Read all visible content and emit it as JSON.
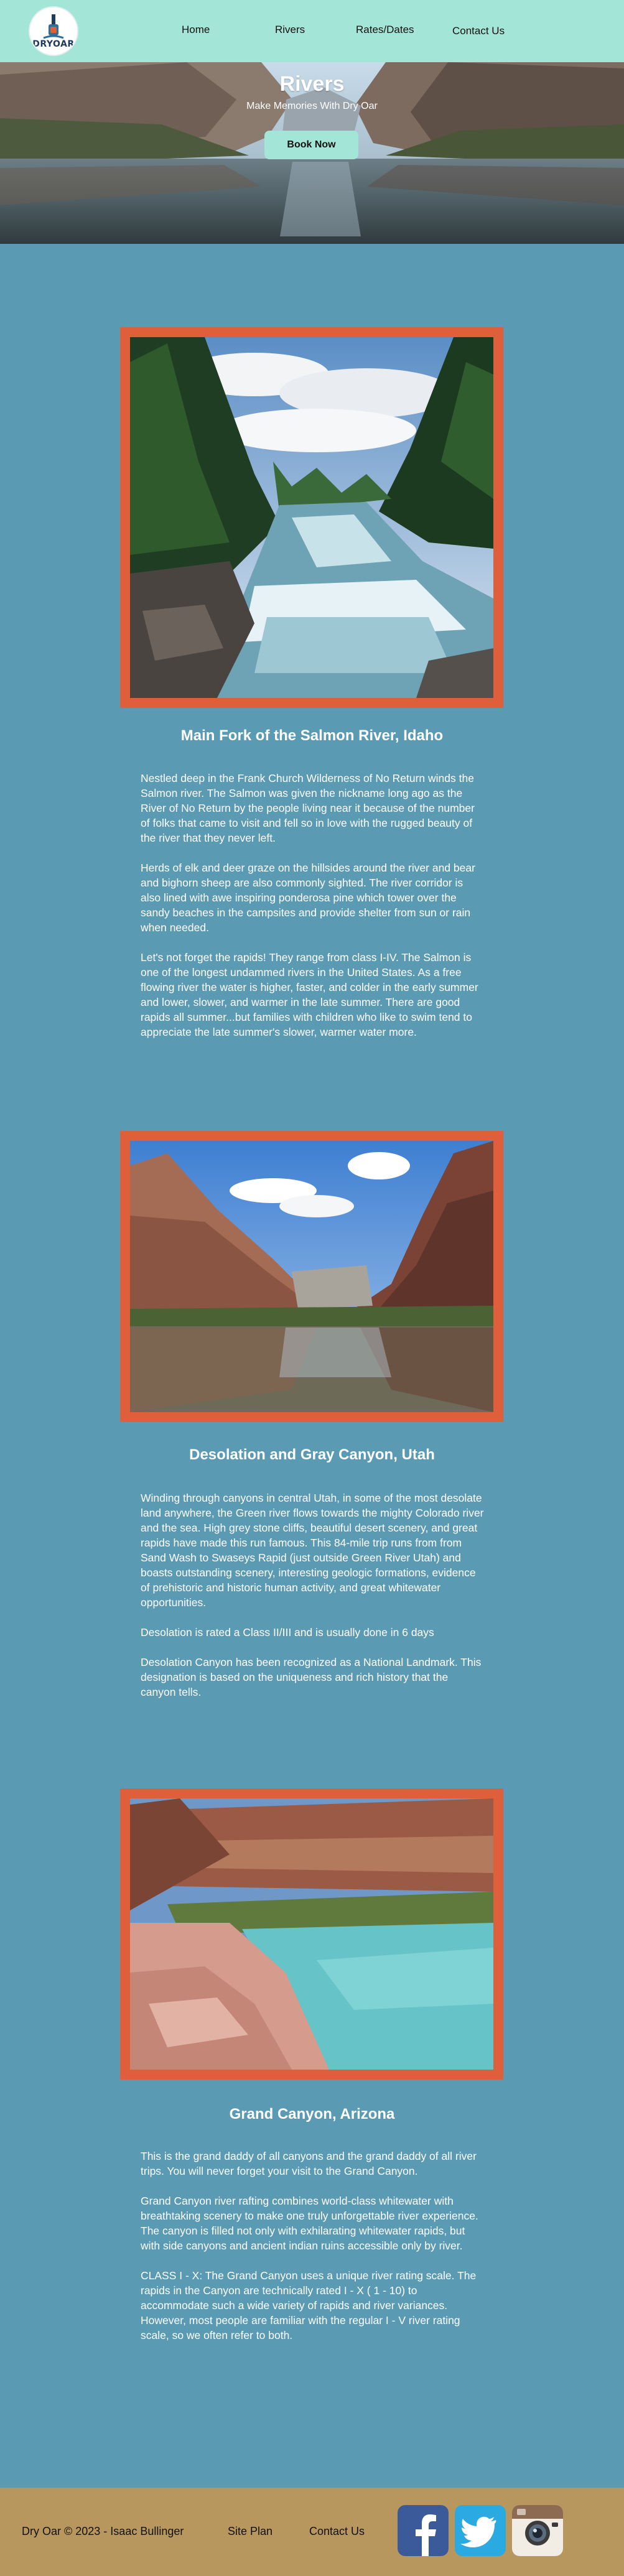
{
  "header": {
    "logo_text": "DRYOAR",
    "nav": [
      "Home",
      "Rivers",
      "Rates/Dates",
      "Contact Us"
    ]
  },
  "hero": {
    "title": "Rivers",
    "subtitle": "Make Memories With Dry Oar",
    "button_label": "Book Now"
  },
  "rivers": [
    {
      "title": "Main Fork of the Salmon River, Idaho",
      "paragraphs": [
        "Nestled deep in the Frank Church Wilderness of No Return winds the Salmon river. The Salmon was given the nickname long ago as the River of No Return by the people living near it because of the number of folks that came to visit and fell so in love with the rugged beauty of the river that they never left.",
        "Herds of elk and deer graze on the hillsides around the river and bear and bighorn sheep are also commonly sighted. The river corridor is also lined with awe inspiring ponderosa pine which tower over the sandy beaches in the campsites and provide shelter from sun or rain when needed.",
        "Let's not forget the rapids! They range from class I-IV. The Salmon is one of the longest undammed rivers in the United States. As a free flowing river the water is higher, faster, and colder in the early summer and lower, slower, and warmer in the late summer. There are good rapids all summer...but families with children who like to swim tend to appreciate the late summer's slower, warmer water more."
      ]
    },
    {
      "title": "Desolation and Gray Canyon, Utah",
      "paragraphs": [
        "Winding through canyons in central Utah, in some of the most desolate land anywhere, the Green river flows towards the mighty Colorado river and the sea. High grey stone cliffs, beautiful desert scenery, and great rapids have made this run famous. This 84-mile trip runs from from Sand Wash to Swaseys Rapid (just outside Green River Utah) and boasts outstanding scenery, interesting geologic formations, evidence of prehistoric and historic human activity, and great whitewater opportunities.",
        "Desolation is rated a Class II/III and is usually done in 6 days",
        "Desolation Canyon has been recognized as a National Landmark.  This designation is based on the uniqueness and rich history that the canyon tells."
      ]
    },
    {
      "title": "Grand Canyon, Arizona",
      "paragraphs": [
        "This is the grand daddy of all canyons and the grand daddy of all river trips. You will never forget your visit to the Grand Canyon.",
        "Grand Canyon river rafting combines world-class whitewater with breathtaking scenery to make one truly unforgettable river experience. The canyon is filled not only with exhilarating whitewater rapids, but with side canyons and ancient indian ruins accessible only by river.",
        "CLASS I - X: The Grand Canyon uses a unique river rating scale. The rapids in the Canyon are technically rated I - X ( 1 - 10) to accommodate such a wide variety of rapids and river variances. However, most people are familiar with the regular I - V river rating scale, so we often refer to both."
      ]
    }
  ],
  "footer": {
    "copyright": "Dry Oar © 2023 - Isaac Bullinger",
    "links": [
      "Site Plan",
      "Contact Us"
    ],
    "social_icons": [
      "facebook-icon",
      "twitter-icon",
      "instagram-icon"
    ]
  },
  "colors": {
    "header_bg": "#a3e5d6",
    "page_bg": "#5b9ab3",
    "frame": "#e05f3b",
    "footer_bg": "#b8975e"
  }
}
